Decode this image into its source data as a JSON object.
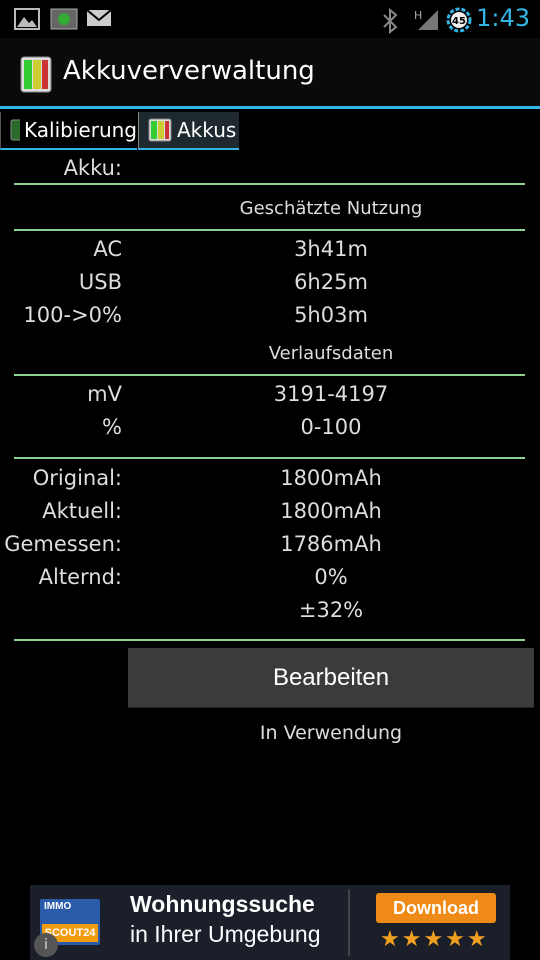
{
  "status_bar": {
    "time": "1:43",
    "battery_level": "45",
    "network": "H"
  },
  "action_bar": {
    "title": "Akkuververwaltung"
  },
  "tabs": [
    {
      "label": "Kalibierung",
      "selected": false
    },
    {
      "label": "Akkus",
      "selected": true
    }
  ],
  "battery": {
    "label": "Akku:",
    "usage_header": "Geschätzte Nutzung",
    "usage": [
      {
        "label": "AC",
        "value": "3h41m"
      },
      {
        "label": "USB",
        "value": "6h25m"
      },
      {
        "label": "100->0%",
        "value": "5h03m"
      }
    ],
    "history_header": "Verlaufsdaten",
    "history": [
      {
        "label": "mV",
        "value": "3191-4197"
      },
      {
        "label": "%",
        "value": "0-100"
      }
    ],
    "capacity": [
      {
        "label": "Original:",
        "value": "1800mAh"
      },
      {
        "label": "Aktuell:",
        "value": "1800mAh"
      },
      {
        "label": "Gemessen:",
        "value": "1786mAh"
      },
      {
        "label": "Alternd:",
        "value": "0%"
      }
    ],
    "tolerance": "±32%",
    "edit_button": "Bearbeiten",
    "status": "In Verwendung"
  },
  "ad": {
    "logo_top": "IMMO",
    "logo_bottom": "SCOUT24",
    "line1": "Wohnungssuche",
    "line2": "in Ihrer Umgebung",
    "download": "Download",
    "stars": "★★★★★",
    "info_icon": "i"
  },
  "colors": {
    "accent": "#33b5e5",
    "rule": "#8fd18f",
    "background": "#000000"
  }
}
